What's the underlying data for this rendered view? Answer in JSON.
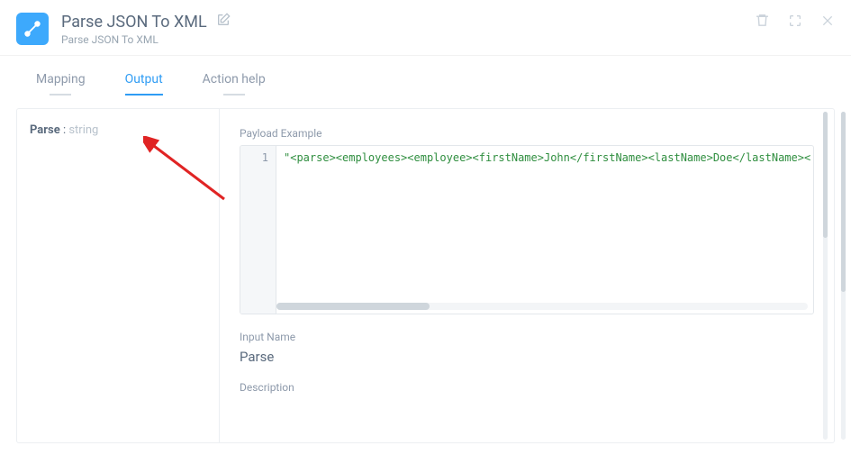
{
  "header": {
    "title": "Parse JSON To XML",
    "subtitle": "Parse JSON To XML"
  },
  "tabs": {
    "mapping": "Mapping",
    "output": "Output",
    "action_help": "Action help"
  },
  "side": {
    "field_name": "Parse",
    "field_sep": " : ",
    "field_type": "string"
  },
  "main": {
    "payload_label": "Payload Example",
    "line_number": "1",
    "code": "\"<parse><employees><employee><firstName>John</firstName><lastName>Doe</lastName><",
    "input_name_label": "Input Name",
    "input_name_value": "Parse",
    "description_label": "Description"
  }
}
